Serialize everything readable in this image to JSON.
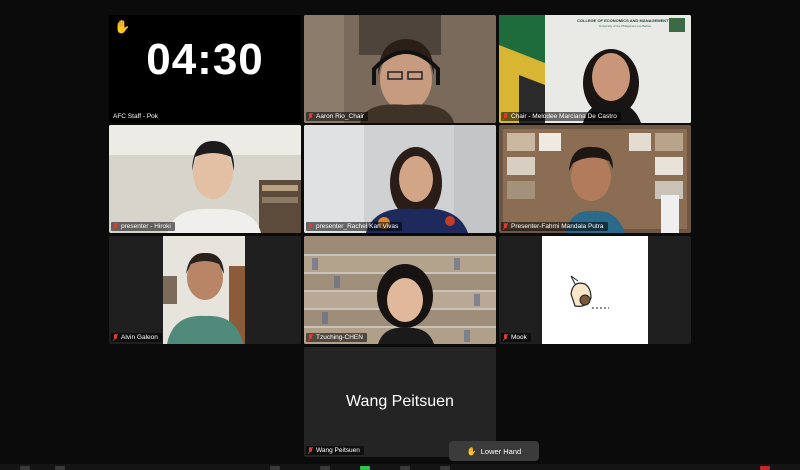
{
  "app": "Zoom Meeting",
  "timer": {
    "value": "04:30",
    "icon": "raised-hand-icon"
  },
  "participants": [
    {
      "name": "AFC Staff - Pok"
    },
    {
      "name": "Aaron Rio_Chair"
    },
    {
      "name": "Chair - Melodee Marciana De Castro",
      "slide_title": "COLLEGE OF ECONOMICS AND MANAGEMENT",
      "slide_subtitle": "University of the Philippines Los Baños"
    },
    {
      "name": "presenter - Hiroki"
    },
    {
      "name": "presenter_Rachel Karl Vivas"
    },
    {
      "name": "Presenter-Fahmi Mandala Putra"
    },
    {
      "name": "Alvin Galeon"
    },
    {
      "name": "Tzuching-CHEN"
    },
    {
      "name": "Mook"
    },
    {
      "name": "Wang Peitsuen",
      "display_text": "Wang Peitsuen"
    }
  ],
  "controls": {
    "lower_hand_label": "Lower Hand",
    "lower_hand_icon": "raised-hand-icon"
  },
  "colors": {
    "active_speaker": "#35c24a",
    "background": "#0b0b0b",
    "tile": "#242424"
  }
}
